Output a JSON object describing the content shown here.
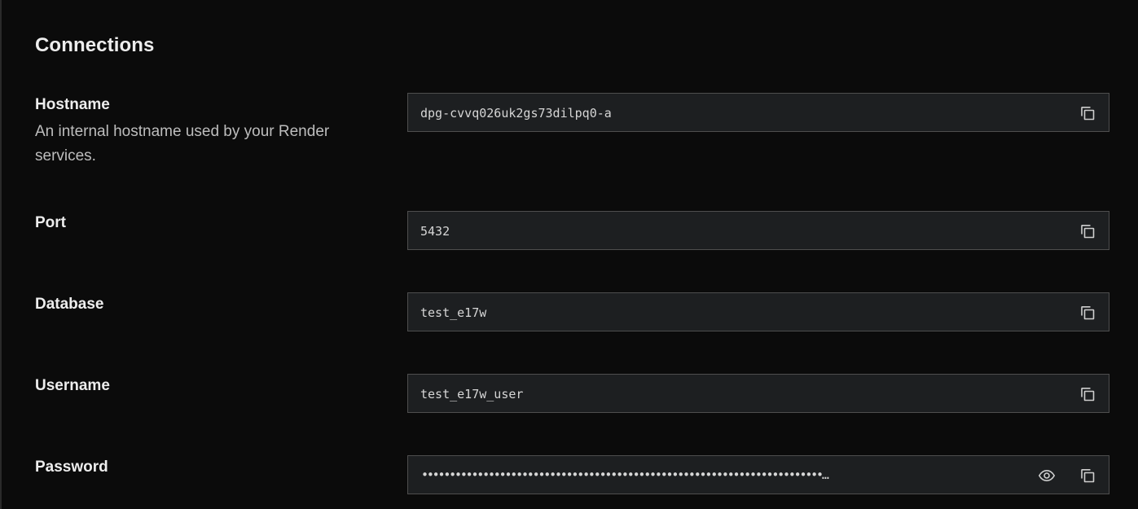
{
  "section": {
    "title": "Connections"
  },
  "fields": {
    "hostname": {
      "label": "Hostname",
      "description": "An internal hostname used by your Render services.",
      "value": "dpg-cvvq026uk2gs73dilpq0-a",
      "copy_icon": "copy-icon"
    },
    "port": {
      "label": "Port",
      "value": "5432",
      "copy_icon": "copy-icon"
    },
    "database": {
      "label": "Database",
      "value": "test_e17w",
      "copy_icon": "copy-icon"
    },
    "username": {
      "label": "Username",
      "value": "test_e17w_user",
      "copy_icon": "copy-icon"
    },
    "password": {
      "label": "Password",
      "masked_value": "••••••••••••••••••••••••••••••••••••••••••••••••••••••••••••••••••••••••…",
      "reveal_icon": "eye-icon",
      "copy_icon": "copy-icon"
    }
  },
  "colors": {
    "background": "#0b0b0b",
    "field_background": "#1d1f21",
    "field_border": "#4e4e4e",
    "text_primary": "#ededed",
    "text_secondary": "#bdbdbd"
  }
}
